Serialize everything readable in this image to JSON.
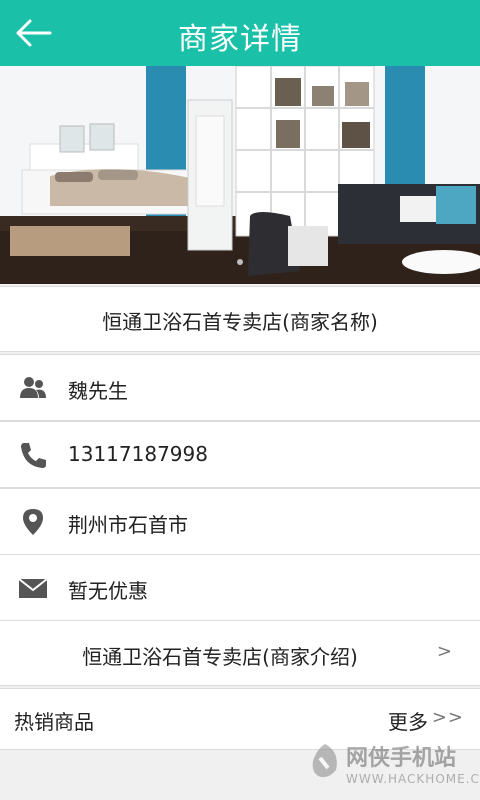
{
  "header": {
    "title": "商家详情",
    "back_icon": "arrow-left-icon"
  },
  "banner": {
    "image": "bedroom-showroom-photo"
  },
  "merchant": {
    "name": "恒通卫浴石首专卖店(商家名称)",
    "contact": "魏先生",
    "phone": "13117187998",
    "address": "荆州市石首市",
    "promotion": "暂无优惠",
    "intro": "恒通卫浴石首专卖店(商家介绍)",
    "intro_arrow": ">"
  },
  "hot_products": {
    "label": "热销商品",
    "more": "更多",
    "more_arrow": ">>"
  },
  "watermark": {
    "brand": "网侠手机站",
    "url": "WWW.HACKHOME.COM"
  },
  "colors": {
    "accent": "#1bc0a8",
    "icon": "#555555"
  }
}
